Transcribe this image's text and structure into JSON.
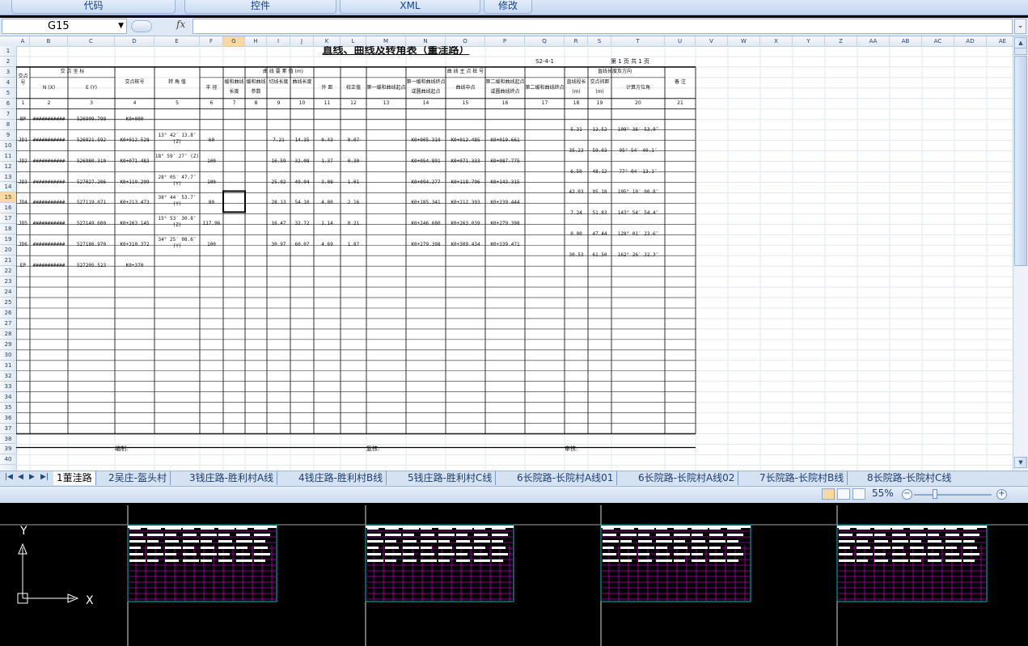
{
  "ribbon": {
    "tabs": [
      "代码",
      "控件",
      "XML",
      "修改"
    ]
  },
  "formula_bar": {
    "name_box": "G15",
    "fx": "fx",
    "value": ""
  },
  "columns": [
    "A",
    "B",
    "C",
    "D",
    "E",
    "F",
    "G",
    "H",
    "I",
    "J",
    "K",
    "L",
    "M",
    "N",
    "O",
    "P",
    "Q",
    "R",
    "S",
    "T",
    "U",
    "V",
    "W",
    "X",
    "Y",
    "Z",
    "AA",
    "AB",
    "AC",
    "AD",
    "AE"
  ],
  "rows": [
    "1",
    "2",
    "3",
    "4",
    "5",
    "6",
    "7",
    "8",
    "9",
    "10",
    "11",
    "12",
    "13",
    "14",
    "15",
    "16",
    "17",
    "18",
    "19",
    "20",
    "21",
    "22",
    "23",
    "24",
    "25",
    "26",
    "27",
    "28",
    "29",
    "30",
    "31",
    "32",
    "33",
    "34",
    "35",
    "36",
    "37",
    "38",
    "39",
    "40"
  ],
  "selected": {
    "column": "G",
    "row": "15"
  },
  "sheet": {
    "title": "直线、曲线及转角表（董洼路）",
    "doc_code": "S2-4-1",
    "page_info": "第 1 页    共 1 页",
    "headers": {
      "point_no": "交点号",
      "coord": "交 点 坐 标",
      "n": "N (X)",
      "e": "E (Y)",
      "stake": "交点桩号",
      "angle": "转 角 值",
      "curve_elems": "曲 线 要 素 值 (m)",
      "radius": "半 径",
      "spiral1_len": "缓和曲线长度",
      "spiral1_param": "缓和曲线参数",
      "tangent": "切线长度",
      "curve_len": "曲线长度",
      "external": "外 距",
      "correction": "校正值",
      "main_points": "曲 线 主 点 桩 号",
      "mp1": "第一缓和曲线起点",
      "mp2": "第一缓和曲线终点或圆曲线起点",
      "mp3": "曲线中点",
      "mp4": "第二缓和曲线起点或圆曲线终点",
      "mp5": "第二缓和曲线终点",
      "line_group": "直线长度及方向",
      "line_len": "直线段长(m)",
      "point_dist": "交点间距(m)",
      "bearing": "计算方位角",
      "remarks": "备 注"
    },
    "col_numbers": [
      "1",
      "2",
      "3",
      "4",
      "5",
      "6",
      "7",
      "8",
      "9",
      "10",
      "11",
      "12",
      "13",
      "14",
      "15",
      "16",
      "17",
      "18",
      "19",
      "20",
      "21"
    ],
    "points": [
      {
        "id": "BP",
        "n": "###########",
        "e": "526909.799",
        "stake": "K0+000",
        "angle": "",
        "radius": "",
        "tangent": "",
        "curve_len": "",
        "external": "",
        "correction": "",
        "mp2": "",
        "mp3": "",
        "mp4": ""
      },
      {
        "id": "JD1",
        "n": "###########",
        "e": "526921.592",
        "stake": "K0+012.528",
        "angle": "13° 42′ 13.8″ (Z)",
        "radius": "60",
        "tangent": "7.21",
        "curve_len": "14.35",
        "external": "0.43",
        "correction": "0.07",
        "mp2": "K0+005.319",
        "mp3": "K0+012.485",
        "mp4": "K0+019.661"
      },
      {
        "id": "JD2",
        "n": "###########",
        "e": "526980.310",
        "stake": "K0+071.483",
        "angle": "18° 59′ 27″ (Z)",
        "radius": "100",
        "tangent": "16.59",
        "curve_len": "32.08",
        "external": "1.37",
        "correction": "0.30",
        "mp2": "K0+054.891",
        "mp3": "K0+071.333",
        "mp4": "K0+087.775"
      },
      {
        "id": "JD3",
        "n": "###########",
        "e": "527027.206",
        "stake": "K0+119.299",
        "angle": "28° 05′ 47.7″ (Y)",
        "radius": "100",
        "tangent": "25.02",
        "curve_len": "49.04",
        "external": "3.08",
        "correction": "1.01",
        "mp2": "K0+094.277",
        "mp3": "K0+118.796",
        "mp4": "K0+143.315"
      },
      {
        "id": "JD4",
        "n": "###########",
        "e": "527119.071",
        "stake": "K0+213.473",
        "angle": "38° 44′ 53.7″ (Y)",
        "radius": "80",
        "tangent": "28.13",
        "curve_len": "54.10",
        "external": "4.80",
        "correction": "2.16",
        "mp2": "K0+185.341",
        "mp3": "K0+212.393",
        "mp4": "K0+239.444"
      },
      {
        "id": "JD5",
        "n": "###########",
        "e": "527149.600",
        "stake": "K0+263.145",
        "angle": "15° 53′ 30.8″ (Z)",
        "radius": "117.96",
        "tangent": "16.47",
        "curve_len": "32.72",
        "external": "1.14",
        "correction": "0.21",
        "mp2": "K0+246.680",
        "mp3": "K0+263.039",
        "mp4": "K0+279.398"
      },
      {
        "id": "JD6",
        "n": "###########",
        "e": "527186.970",
        "stake": "K0+310.372",
        "angle": "34° 25′ 08.6″ (Y)",
        "radius": "100",
        "tangent": "30.97",
        "curve_len": "60.07",
        "external": "4.69",
        "correction": "1.87",
        "mp2": "K0+279.398",
        "mp3": "K0+309.434",
        "mp4": "K0+339.471"
      },
      {
        "id": "EP",
        "n": "###########",
        "e": "527205.523",
        "stake": "K0+370",
        "angle": "",
        "radius": "",
        "tangent": "",
        "curve_len": "",
        "external": "",
        "correction": "",
        "mp2": "",
        "mp3": "",
        "mp4": ""
      }
    ],
    "segments": [
      {
        "line_len": "5.31",
        "dist": "12.52",
        "bearing": "109° 36′ 53.9″"
      },
      {
        "line_len": "35.23",
        "dist": "59.03",
        "bearing": "95° 54′ 40.1″"
      },
      {
        "line_len": "6.50",
        "dist": "48.12",
        "bearing": "77° 04′ 13.1″"
      },
      {
        "line_len": "42.03",
        "dist": "95.18",
        "bearing": "105° 10′ 00.8″"
      },
      {
        "line_len": "7.24",
        "dist": "51.83",
        "bearing": "143° 54′ 54.4″"
      },
      {
        "line_len": "0.00",
        "dist": "47.44",
        "bearing": "128° 01′ 23.6″"
      },
      {
        "line_len": "30.53",
        "dist": "61.50",
        "bearing": "162° 26′ 32.3″"
      }
    ],
    "footer": {
      "prepared": "编制:",
      "reviewed": "复核:",
      "audited": "审核:"
    }
  },
  "sheet_tabs": [
    "1董洼路",
    "2吴庄-盔头村",
    "3钱庄路-胜利村A线",
    "4钱庄路-胜利村B线",
    "5钱庄路-胜利村C线",
    "6长院路-长院村A线01",
    "6长院路-长院村A线02",
    "7长院路-长院村B线",
    "8长院路-长院村C线"
  ],
  "active_tab": "1董洼路",
  "status": {
    "zoom": "55%"
  },
  "cad": {
    "axis_y": "Y",
    "axis_x": "X"
  },
  "colors": {
    "accent": "#15428b",
    "cad_grid": "#b000b0",
    "cad_frame": "#00c0c0"
  }
}
